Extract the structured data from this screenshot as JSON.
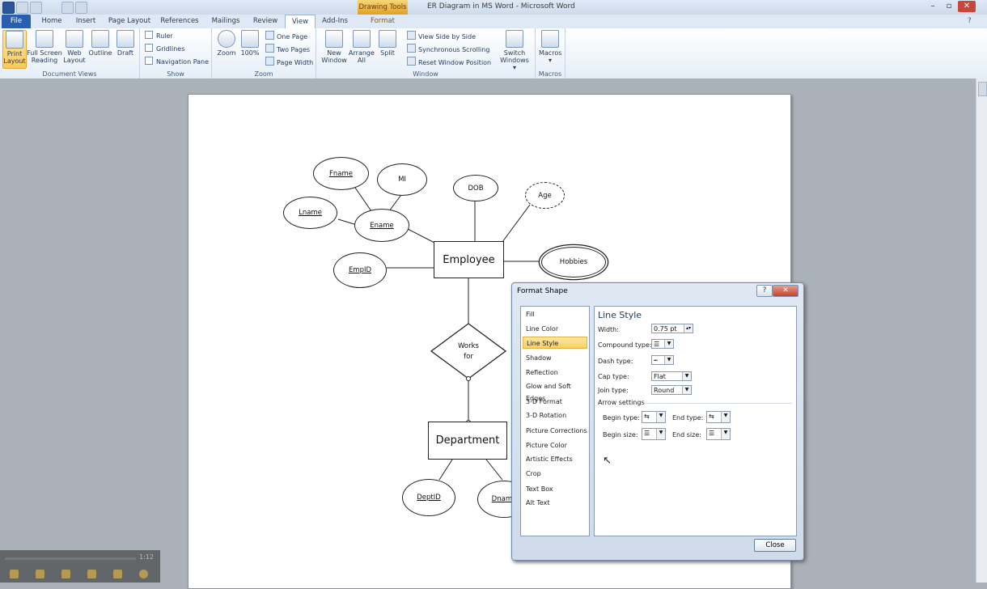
{
  "window": {
    "title": "ER Diagram in MS Word - Microsoft Word",
    "context_tab_group": "Drawing Tools"
  },
  "tabs": [
    "File",
    "Home",
    "Insert",
    "Page Layout",
    "References",
    "Mailings",
    "Review",
    "View",
    "Add-Ins",
    "Format"
  ],
  "ribbon": {
    "document_views": {
      "label": "Document Views",
      "buttons": [
        "Print Layout",
        "Full Screen Reading",
        "Web Layout",
        "Outline",
        "Draft"
      ]
    },
    "show": {
      "label": "Show",
      "checkboxes": [
        "Ruler",
        "Gridlines",
        "Navigation Pane"
      ]
    },
    "zoom": {
      "label": "Zoom",
      "zoom": "Zoom",
      "hundred": "100%",
      "one_page": "One Page",
      "two_pages": "Two Pages",
      "page_width": "Page Width"
    },
    "window": {
      "label": "Window",
      "new_window": "New Window",
      "arrange_all": "Arrange All",
      "split": "Split",
      "view_side_by_side": "View Side by Side",
      "sync_scrolling": "Synchronous Scrolling",
      "reset_position": "Reset Window Position",
      "switch_windows": "Switch Windows"
    },
    "macros": {
      "label": "Macros",
      "button": "Macros"
    }
  },
  "diagram": {
    "attributes": [
      "Fname",
      "MI",
      "Lname",
      "Ename",
      "DOB",
      "Age",
      "EmpID",
      "Hobbies",
      "DeptID",
      "Dname"
    ],
    "entities": {
      "employee": "Employee",
      "department": "Department"
    },
    "relationship": {
      "line1": "Works",
      "line2": "for"
    }
  },
  "dialog": {
    "title": "Format Shape",
    "categories": [
      "Fill",
      "Line Color",
      "Line Style",
      "Shadow",
      "Reflection",
      "Glow and Soft Edges",
      "3-D Format",
      "3-D Rotation",
      "Picture Corrections",
      "Picture Color",
      "Artistic Effects",
      "Crop",
      "Text Box",
      "Alt Text"
    ],
    "selected_category": "Line Style",
    "section_title": "Line Style",
    "width_label": "Width:",
    "width_value": "0.75 pt",
    "compound_label": "Compound type:",
    "dash_label": "Dash type:",
    "cap_label": "Cap type:",
    "cap_value": "Flat",
    "join_label": "Join type:",
    "join_value": "Round",
    "arrow_settings": "Arrow settings",
    "begin_type": "Begin type:",
    "end_type": "End type:",
    "begin_size": "Begin size:",
    "end_size": "End size:",
    "close": "Close"
  },
  "media": {
    "time": "1:12"
  }
}
